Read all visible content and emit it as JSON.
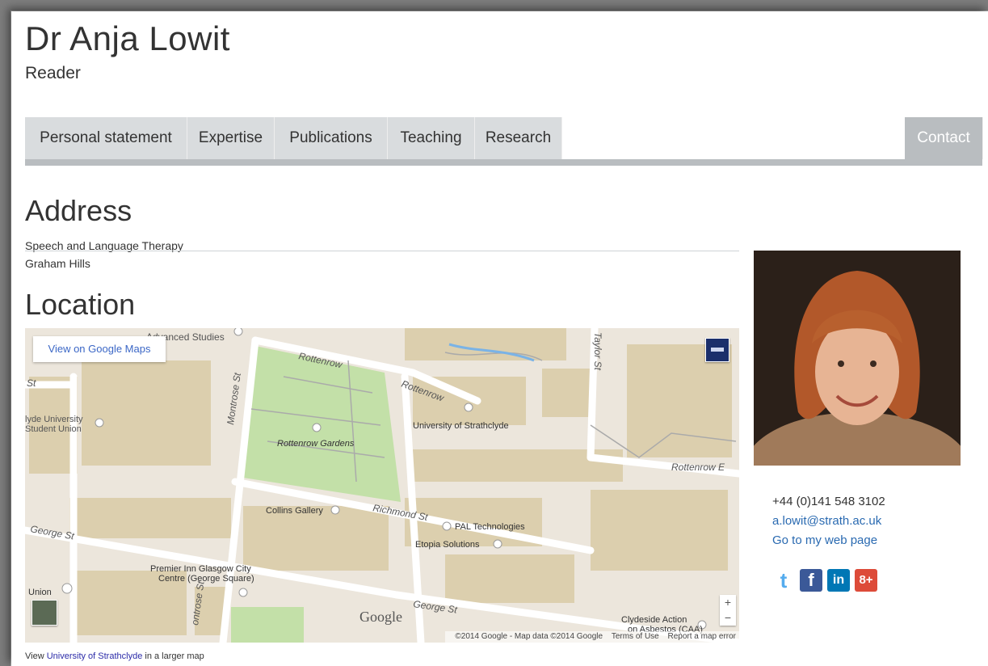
{
  "profile": {
    "name": "Dr Anja Lowit",
    "title": "Reader"
  },
  "tabs": [
    {
      "label": "Personal statement",
      "active": false
    },
    {
      "label": "Expertise",
      "active": false
    },
    {
      "label": "Publications",
      "active": false
    },
    {
      "label": "Teaching",
      "active": false
    },
    {
      "label": "Research",
      "active": false
    },
    {
      "label": "Contact",
      "active": true
    }
  ],
  "address": {
    "heading": "Address",
    "lines": [
      "Speech and Language Therapy",
      "Graham Hills"
    ]
  },
  "location": {
    "heading": "Location",
    "map": {
      "view_button": "View on Google Maps",
      "labels": {
        "advanced_studies": "Advanced Studies",
        "rottenrow_1": "Rottenrow",
        "rottenrow_2": "Rottenrow",
        "rottenrow_e": "Rottenrow E",
        "taylor_st": "Taylor St",
        "st_left": "St",
        "student_union": "lyde University\nStudent Union",
        "montrose_st": "Montrose St",
        "montrose_st_2": "ontrose St",
        "rottenrow_gardens": "Rottenrow Gardens",
        "university_of_strathclyde": "University of Strathclyde",
        "collins_gallery": "Collins Gallery",
        "richmond_st": "Richmond St",
        "pal_technologies": "PAL Technologies",
        "etopia_solutions": "Etopia Solutions",
        "george_st_left": "George St",
        "george_st": "George St",
        "premier_inn": "Premier Inn Glasgow City\nCentre (George Square)",
        "union": "Union",
        "clydeside_action": "Clydeside Action\non Asbestos (CAA)",
        "google": "Google"
      },
      "footer": {
        "copyright": "©2014 Google - Map data ©2014 Google",
        "terms": "Terms of Use",
        "report": "Report a map error"
      },
      "zoom_in": "+",
      "zoom_out": "−"
    },
    "caption_prefix": "View",
    "caption_link": "University of Strathclyde",
    "caption_suffix": "in a larger map"
  },
  "contact": {
    "phone": "+44 (0)141 548 3102",
    "email": "a.lowit@strath.ac.uk",
    "web_link": "Go to my web page"
  },
  "social": [
    {
      "icon": "twitter-icon",
      "glyph": "t",
      "color": "#55acee"
    },
    {
      "icon": "facebook-icon",
      "glyph": "f",
      "color": "#3b5998"
    },
    {
      "icon": "linkedin-icon",
      "glyph": "in",
      "color": "#0077b5"
    },
    {
      "icon": "google-plus-icon",
      "glyph": "8+",
      "color": "#dd4b39"
    }
  ],
  "colors": {
    "tab_bg": "#d9dcde",
    "tab_active": "#b9bdc0",
    "link": "#2a6ab1",
    "map_land": "#ece6dc",
    "map_buildings": "#d8c9a6",
    "map_park": "#c3e0a8"
  }
}
